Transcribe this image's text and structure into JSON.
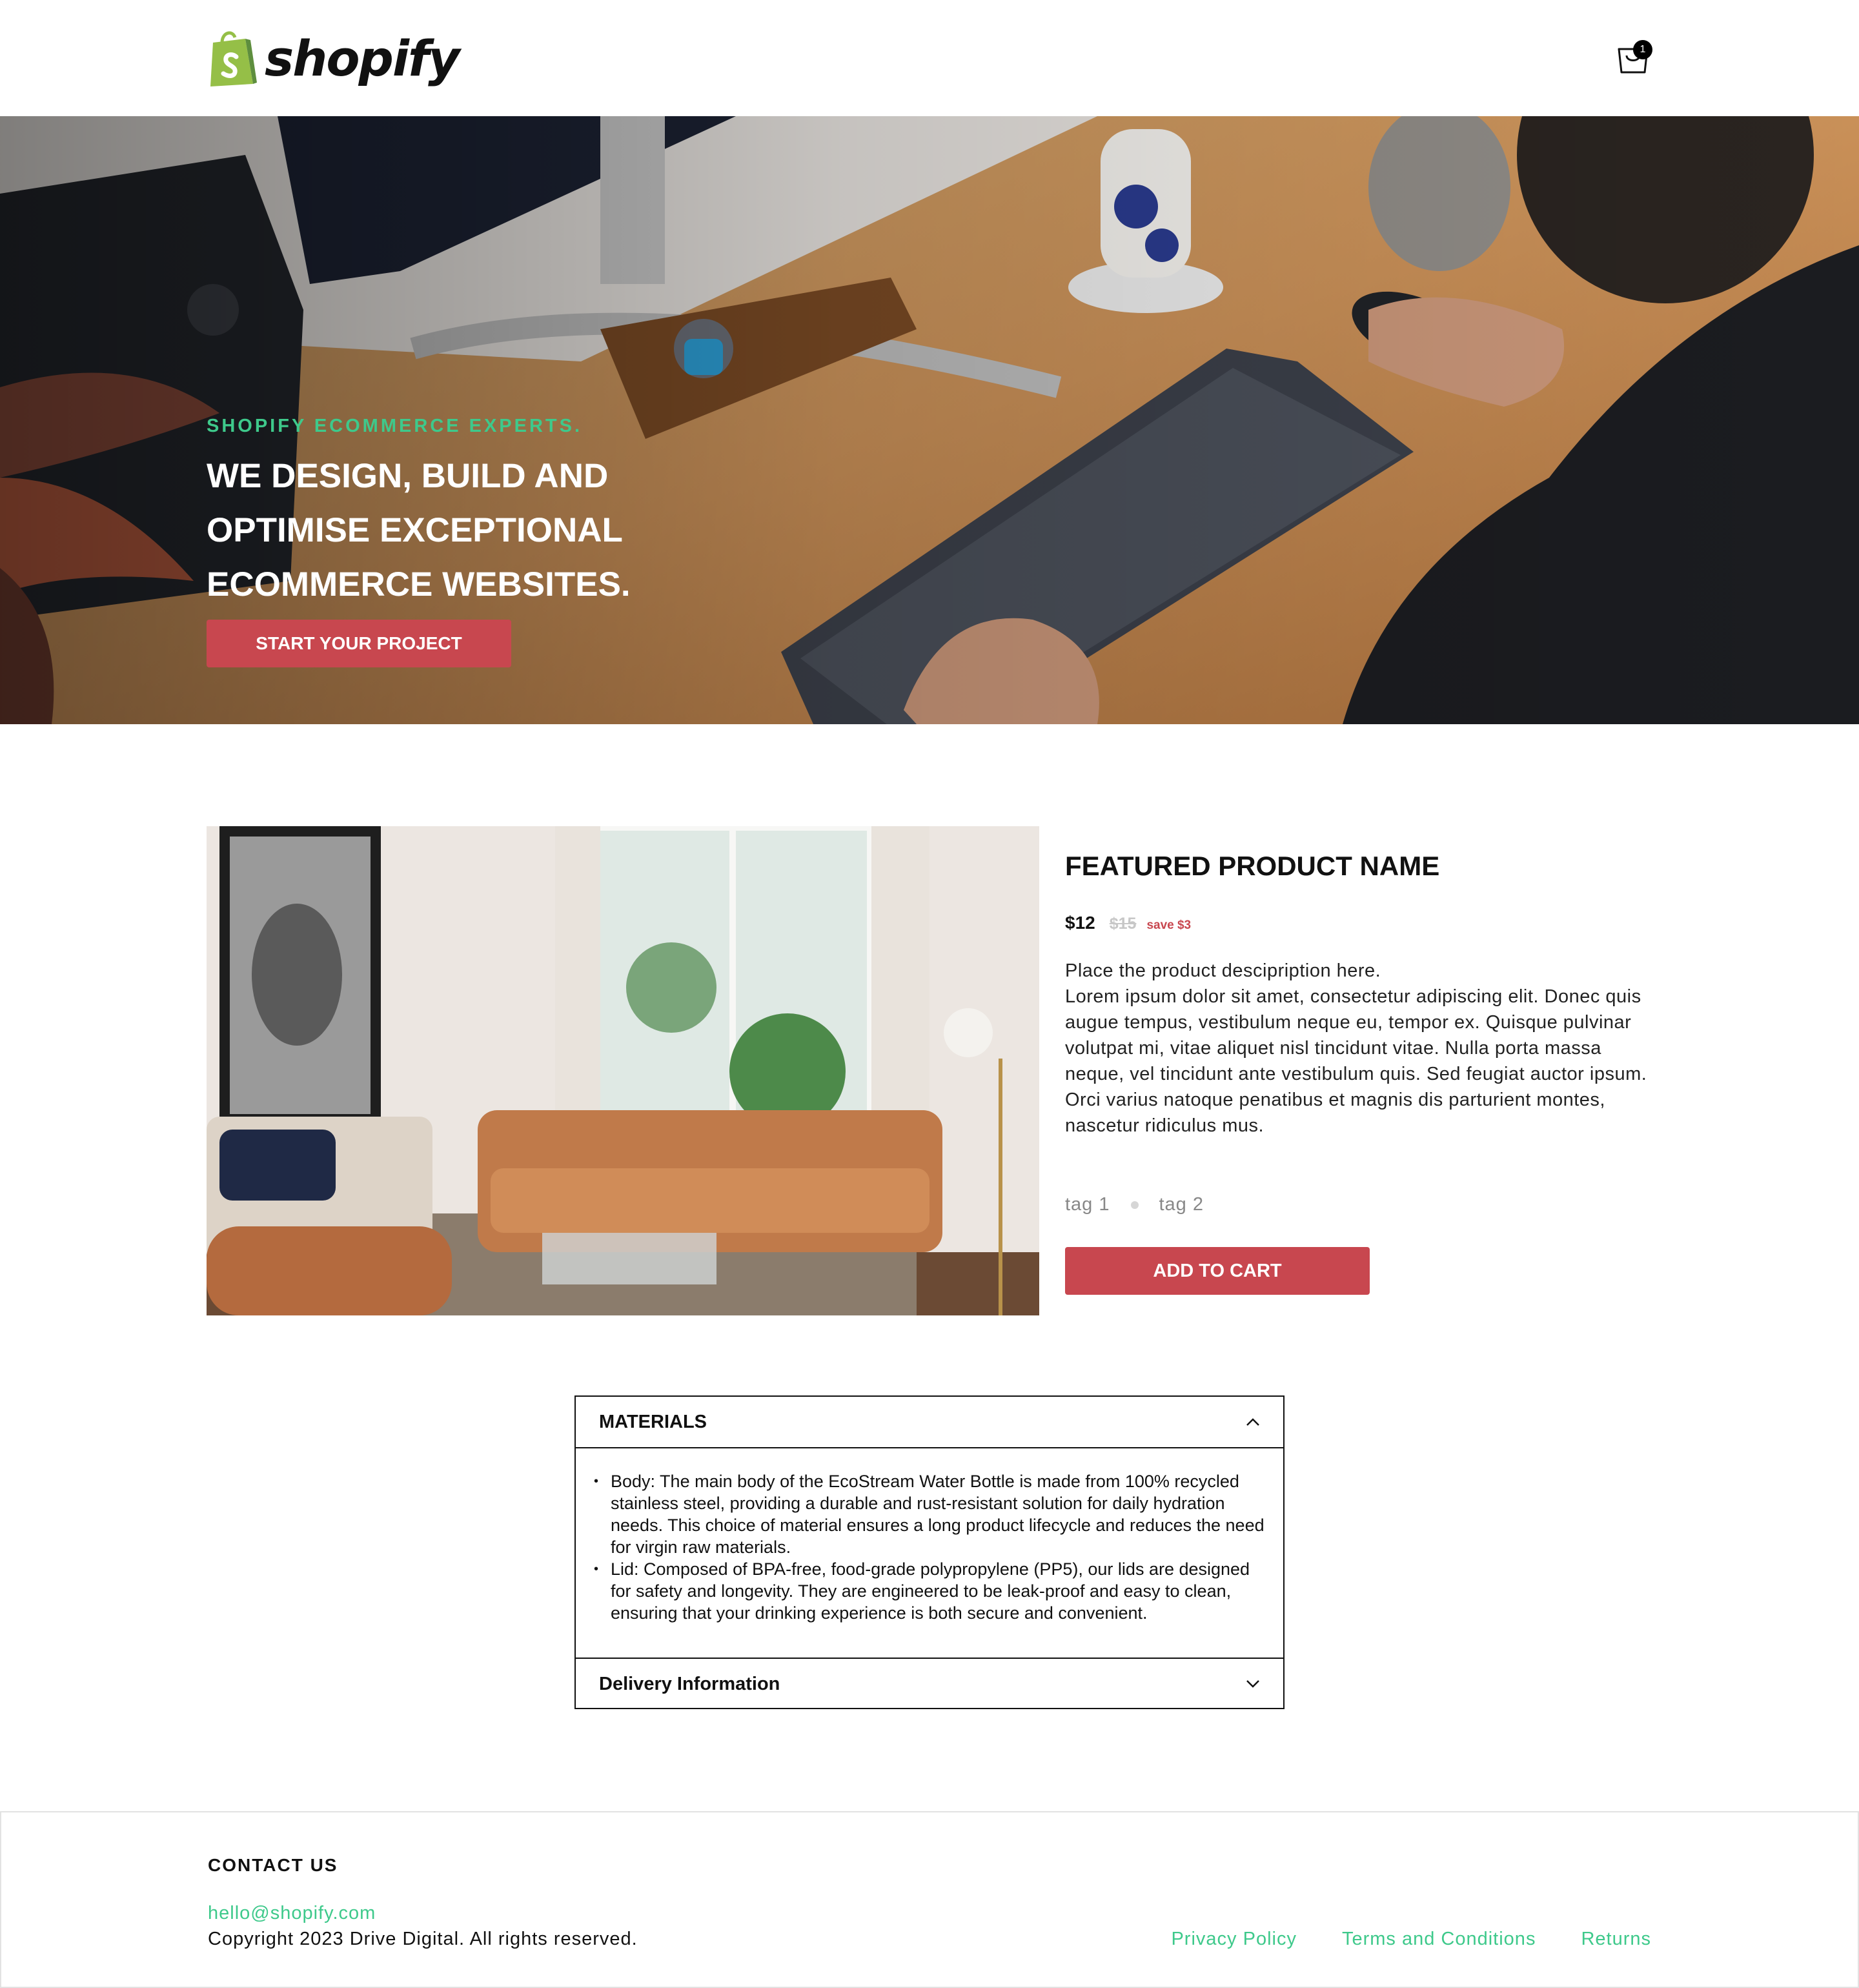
{
  "header": {
    "logo_text": "shopify",
    "cart_count": "1"
  },
  "hero": {
    "eyebrow": "SHOPIFY ECOMMERCE EXPERTS.",
    "title_line1": "WE DESIGN, BUILD AND",
    "title_line2": "OPTIMISE EXCEPTIONAL",
    "title_line3": "ECOMMERCE WEBSITES.",
    "cta_label": "START YOUR PROJECT"
  },
  "product": {
    "title": "FEATURED PRODUCT NAME",
    "price": "$12",
    "price_old": "$15",
    "save_label": "save $3",
    "description_line1": "Place the product descipription here.",
    "description_line2": "Lorem ipsum dolor sit amet, consectetur adipiscing elit. Donec quis augue tempus, vestibulum neque eu, tempor ex. Quisque pulvinar volutpat mi, vitae aliquet nisl tincidunt vitae. Nulla porta massa neque, vel tincidunt ante vestibulum quis. Sed feugiat auctor ipsum. Orci varius natoque penatibus et magnis dis parturient montes, nascetur ridiculus mus.",
    "tags": [
      "tag 1",
      "tag 2"
    ],
    "add_to_cart_label": "ADD TO CART"
  },
  "accordion": {
    "section1_title": "MATERIALS",
    "section1_expanded": true,
    "items": [
      "Body: The main body of the EcoStream Water Bottle is made from 100% recycled stainless steel, providing a durable and rust-resistant solution for daily hydration needs. This choice of material ensures a long product lifecycle and reduces the need for virgin raw materials.",
      "Lid: Composed of BPA-free, food-grade polypropylene (PP5), our lids are designed for safety and longevity. They are engineered to be leak-proof and easy to clean, ensuring that your drinking experience is both secure and convenient."
    ],
    "section2_title": "Delivery Information",
    "section2_expanded": false
  },
  "footer": {
    "heading": "CONTACT US",
    "email": "hello@shopify.com",
    "copyright": "Copyright 2023 Drive Digital. All rights reserved.",
    "links": [
      "Privacy Policy",
      "Terms and Conditions",
      "Returns"
    ]
  },
  "colors": {
    "accent_red": "#c8474f",
    "accent_green": "#3ec98b",
    "logo_green": "#95bf47"
  },
  "icons": [
    "shopify-bag-icon",
    "cart-icon",
    "chevron-up-icon",
    "chevron-down-icon"
  ]
}
